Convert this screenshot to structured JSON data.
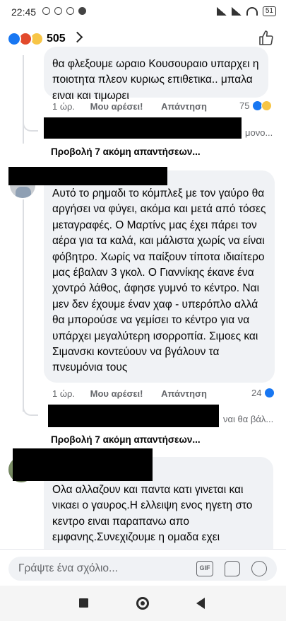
{
  "status_bar": {
    "time": "22:45",
    "battery": "51"
  },
  "header": {
    "reaction_count": "505"
  },
  "comment1": {
    "text": "θα φλεξουμε ωραιο Κουσουραιο υπαρχει η ποιοτητα πλεον κυριως επιθετικα.. μπαλα ειναι και τιμωρει",
    "time": "1 ώρ.",
    "like": "Μου αρέσει!",
    "reply": "Απάντηση",
    "reaction_count": "75",
    "reply_preview": "μονο...",
    "more_replies": "Προβολή 7 ακόμη απαντήσεων..."
  },
  "comment2": {
    "text": "Αυτό το ρημαδι το κόμπλεξ με τον γαύρο θα αργήσει να φύγει, ακόμα και μετά από τόσες μεταγραφές. Ο Μαρτίνς μας έχει πάρει τον αέρα για τα καλά, και μάλιστα χωρίς να είναι φόβητρο. Χωρίς να παίξουν τίποτα ιδιαίτερο μας έβαλαν 3 γκολ. Ο Γιαννίκης έκανε ένα χοντρό λάθος, άφησε γυμνό το κέντρο. Ναι μεν δεν έχουμε έναν χαφ - υπερόπλο αλλά θα μπορούσε να γεμίσει το κέντρο για να υπάρχει μεγαλύτερη ισορροπία. Σιμοες και Σιμανσκι κοντεύουν να βγάλουν τα πνευμόνια τους",
    "time": "1 ώρ.",
    "like": "Μου αρέσει!",
    "reply": "Απάντηση",
    "reaction_count": "24",
    "reply_preview": "ναι θα βάλ...",
    "more_replies": "Προβολή 7 ακόμη απαντήσεων..."
  },
  "comment3": {
    "text": "Ολα αλλαζουν και παντα κατι γινεται και νικαει ο γαυρος.Η ελλειψη ενος ηγετη στο κεντρο ειναι παραπανω απο εμφανης.Συνεχιζουμε η ομαδα εχει"
  },
  "composer": {
    "placeholder": "Γράψτε ένα σχόλιο...",
    "gif_label": "GIF"
  },
  "colors": {
    "facebook_blue": "#1877f2",
    "bubble_bg": "#f0f2f5",
    "meta_gray": "#65676b"
  }
}
